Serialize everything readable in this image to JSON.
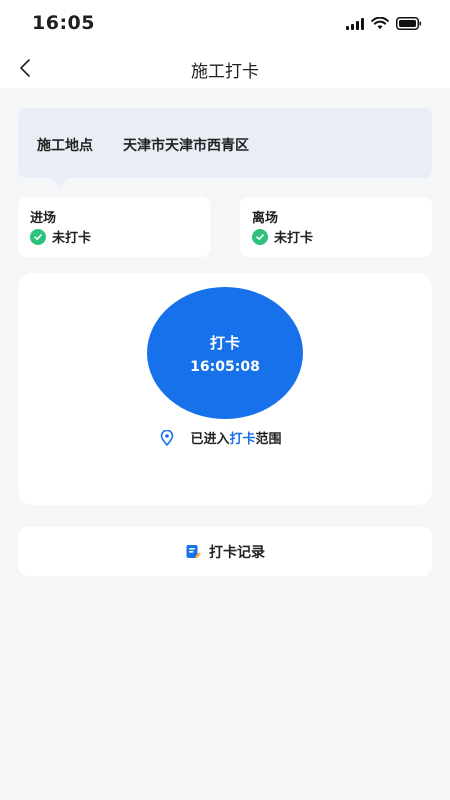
{
  "status_bar": {
    "time": "16:05",
    "icons": [
      "signal-icon",
      "wifi-icon",
      "battery-icon"
    ]
  },
  "nav": {
    "back_icon": "chevron-left-icon",
    "title": "施工打卡"
  },
  "location": {
    "label": "施工地点",
    "value": "天津市天津市西青区"
  },
  "entry_card": {
    "title": "进场",
    "status": "未打卡",
    "icon": "check-circle-icon"
  },
  "exit_card": {
    "title": "离场",
    "status": "未打卡",
    "icon": "check-circle-icon"
  },
  "punch": {
    "label": "打卡",
    "time": "16:05:08",
    "range_prefix": "已进入",
    "range_highlight": "打卡",
    "range_suffix": "范围",
    "icon": "location-pin-icon"
  },
  "records": {
    "label": "打卡记录",
    "icon": "clipboard-edit-icon"
  },
  "colors": {
    "accent": "#1671ea",
    "success": "#2fc27d",
    "page_background": "#f5f6f8",
    "location_background": "#e9eef6"
  }
}
